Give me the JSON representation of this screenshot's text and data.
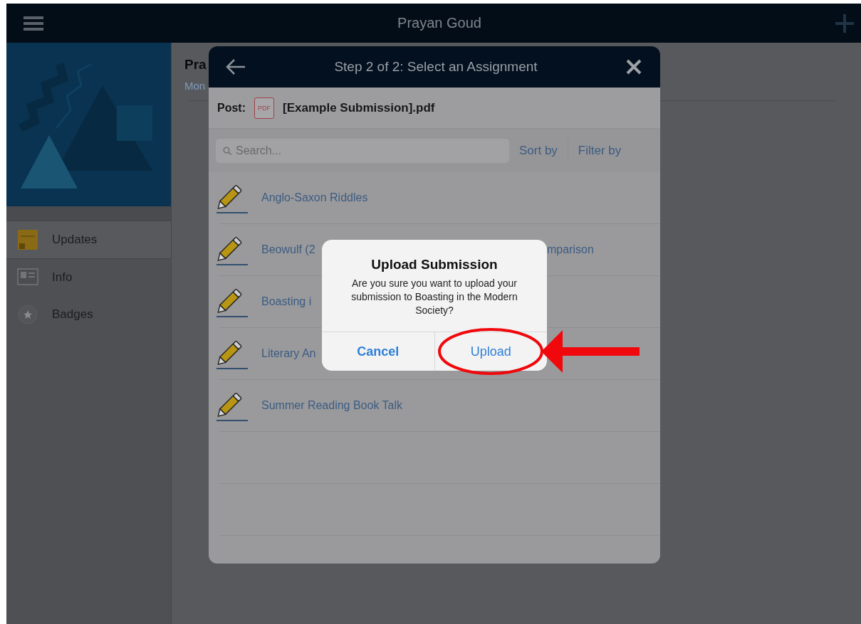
{
  "topbar": {
    "title": "Prayan Goud"
  },
  "sidebar": {
    "items": [
      {
        "label": "Updates",
        "selected": true
      },
      {
        "label": "Info",
        "selected": false
      },
      {
        "label": "Badges",
        "selected": false
      }
    ]
  },
  "main": {
    "heading": "Pra",
    "subheading": "Mon"
  },
  "modal": {
    "title": "Step 2 of 2: Select an Assignment",
    "post_label": "Post:",
    "file_badge": "PDF",
    "file_name": "[Example Submission].pdf",
    "search": {
      "placeholder": "Search..."
    },
    "sort_button": "Sort by",
    "filter_button": "Filter by",
    "assignments": [
      {
        "title": "Anglo-Saxon Riddles"
      },
      {
        "title": "Beowulf (2",
        "title_tail": "mparison"
      },
      {
        "title": "Boasting i"
      },
      {
        "title": "Literary An"
      },
      {
        "title": "Summer Reading Book Talk"
      }
    ]
  },
  "alert": {
    "title": "Upload Submission",
    "message": "Are you sure you want to upload your submission to Boasting in the Modern Society?",
    "buttons": [
      {
        "label": "Cancel",
        "kind": "cancel"
      },
      {
        "label": "Upload",
        "kind": "default"
      }
    ]
  }
}
